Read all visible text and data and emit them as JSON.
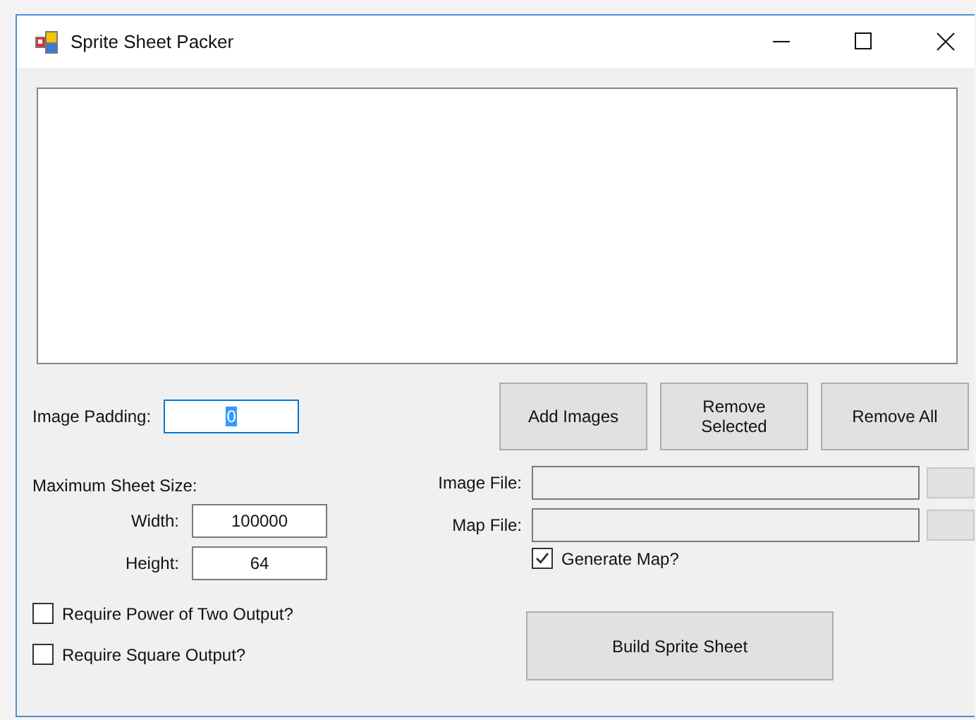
{
  "window": {
    "title": "Sprite Sheet Packer"
  },
  "padding": {
    "label": "Image Padding:",
    "value": "0",
    "focused": true
  },
  "buttons": [
    {
      "label": "Add Images"
    },
    {
      "label": "Remove Selected"
    },
    {
      "label": "Remove All"
    }
  ],
  "sheet_size": {
    "label": "Maximum Sheet Size:",
    "fields": [
      {
        "label": "Width:",
        "value": "100000"
      },
      {
        "label": "Height:",
        "value": "64"
      }
    ]
  },
  "options": [
    {
      "label": "Require Power of Two Output?",
      "checked": false
    },
    {
      "label": "Require Square Output?",
      "checked": false
    }
  ],
  "files": [
    {
      "label": "Image File:"
    },
    {
      "label": "Map File:"
    }
  ],
  "generate_map": {
    "label": "Generate Map?",
    "checked": true
  },
  "build_button": {
    "label": "Build Sprite Sheet"
  }
}
